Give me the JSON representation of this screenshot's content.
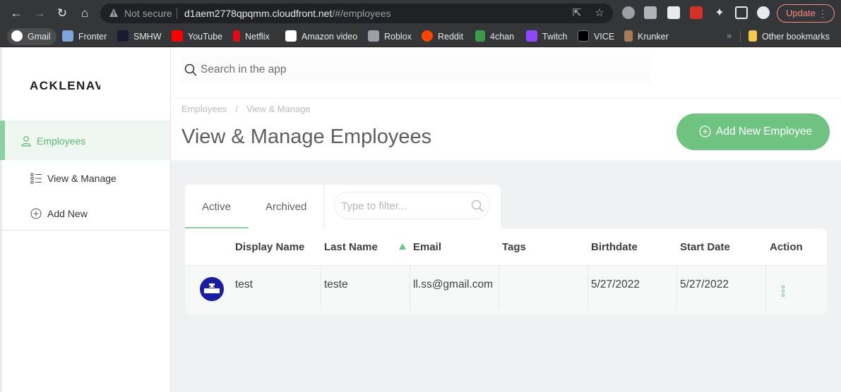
{
  "browser": {
    "security_label": "Not secure",
    "url_host": "d1aem2778qpqmm.cloudfront.net",
    "url_path": "/#/employees",
    "update_label": "Update",
    "bookmarks": [
      {
        "label": "Gmail",
        "icon": "google-icon",
        "color": "#ffffff"
      },
      {
        "label": "Fronter",
        "icon": "fronter-icon",
        "color": "#7aa7d8"
      },
      {
        "label": "SMHW",
        "icon": "smhw-icon",
        "color": "#1b1b2f"
      },
      {
        "label": "YouTube",
        "icon": "youtube-icon",
        "color": "#ff0000"
      },
      {
        "label": "Netflix",
        "icon": "netflix-icon",
        "color": "#e50914"
      },
      {
        "label": "Amazon video",
        "icon": "amazon-icon",
        "color": "#ffffff"
      },
      {
        "label": "Roblox",
        "icon": "roblox-icon",
        "color": "#9aa0a6"
      },
      {
        "label": "Reddit",
        "icon": "reddit-icon",
        "color": "#ff4500"
      },
      {
        "label": "4chan",
        "icon": "4chan-icon",
        "color": "#3c9a4a"
      },
      {
        "label": "Twitch",
        "icon": "twitch-icon",
        "color": "#9146ff"
      },
      {
        "label": "VICE",
        "icon": "vice-icon",
        "color": "#000000"
      },
      {
        "label": "Krunker",
        "icon": "krunker-icon",
        "color": "#a77b55"
      }
    ],
    "other_bookmarks": "Other bookmarks"
  },
  "app": {
    "logo": "ACKLENAVE",
    "search_placeholder": "Search in the app",
    "sidebar": {
      "section": "Employees",
      "items": [
        "View & Manage",
        "Add New"
      ]
    },
    "breadcrumb": [
      "Employees",
      "/",
      "View & Manage"
    ],
    "page_title": "View & Manage Employees",
    "add_button": "Add New Employee",
    "tabs": [
      "Active",
      "Archived"
    ],
    "filter_placeholder": "Type to filter...",
    "table": {
      "columns": [
        "Display Name",
        "Last Name",
        "Email",
        "Tags",
        "Birthdate",
        "Start Date",
        "Action"
      ],
      "sorted_column": "Email",
      "rows": [
        {
          "display_name": "test",
          "last_name": "teste",
          "email": "ll.ss@gmail.com",
          "tags": "",
          "birthdate": "5/27/2022",
          "start_date": "5/27/2022"
        }
      ]
    },
    "accent_color": "#71c382"
  }
}
